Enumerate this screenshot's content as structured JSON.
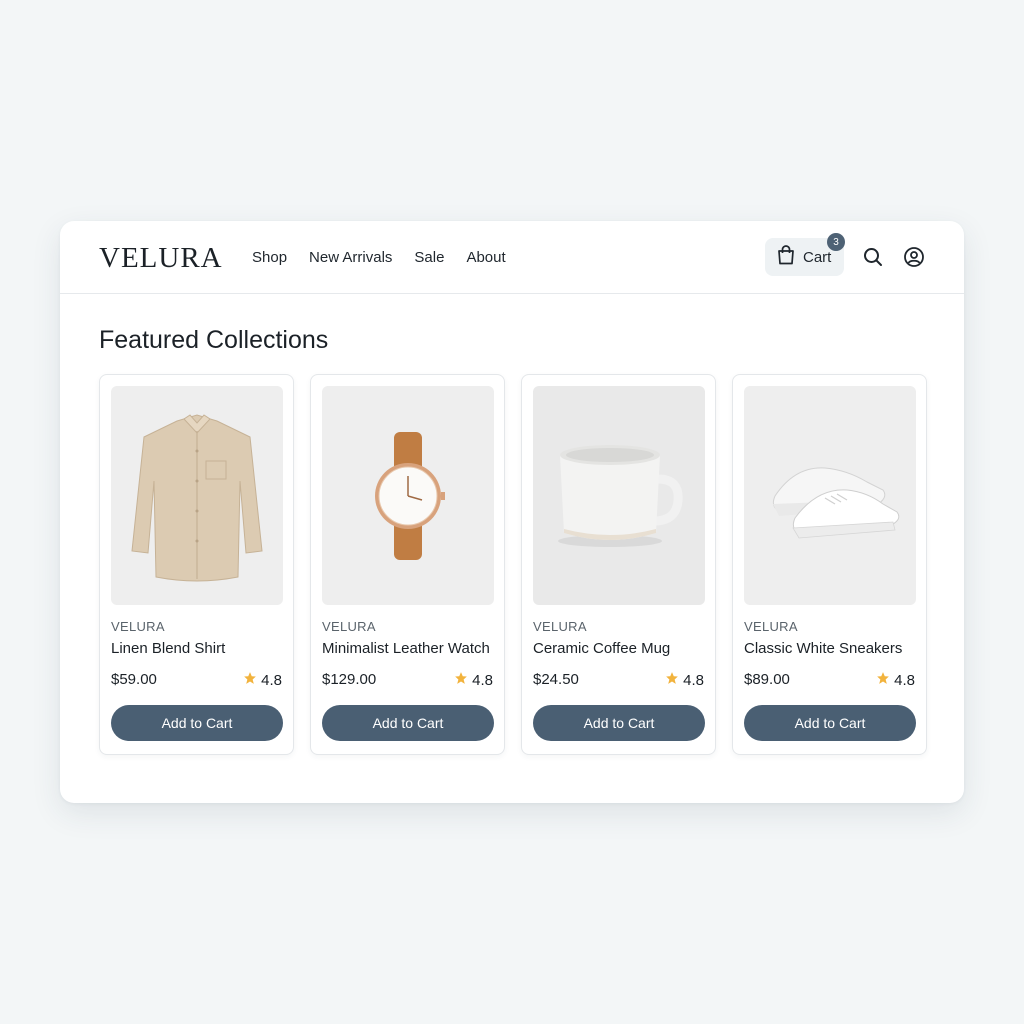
{
  "brand_logo": "VELURA",
  "nav": {
    "items": [
      "Shop",
      "New Arrivals",
      "Sale",
      "About"
    ]
  },
  "header": {
    "cart_label": "Cart",
    "cart_count": "3",
    "icons": [
      "shopping-bag-icon",
      "search-icon",
      "user-account-icon"
    ]
  },
  "section_title": "Featured Collections",
  "products": [
    {
      "brand": "VELURA",
      "name": "Linen Blend Shirt",
      "price": "$59.00",
      "rating": "4.8",
      "button": "Add to Cart",
      "image": "linen-shirt-image"
    },
    {
      "brand": "VELURA",
      "name": "Minimalist Leather Watch",
      "price": "$129.00",
      "rating": "4.8",
      "button": "Add to Cart",
      "image": "leather-watch-image"
    },
    {
      "brand": "VELURA",
      "name": "Ceramic Coffee Mug",
      "price": "$24.50",
      "rating": "4.8",
      "button": "Add to Cart",
      "image": "coffee-mug-image"
    },
    {
      "brand": "VELURA",
      "name": "Classic White Sneakers",
      "price": "$89.00",
      "rating": "4.8",
      "button": "Add to Cart",
      "image": "white-sneakers-image"
    }
  ],
  "colors": {
    "button": "#4a5f73",
    "badge": "#4e6275",
    "star": "#f2b33d",
    "background": "#f3f6f7"
  }
}
